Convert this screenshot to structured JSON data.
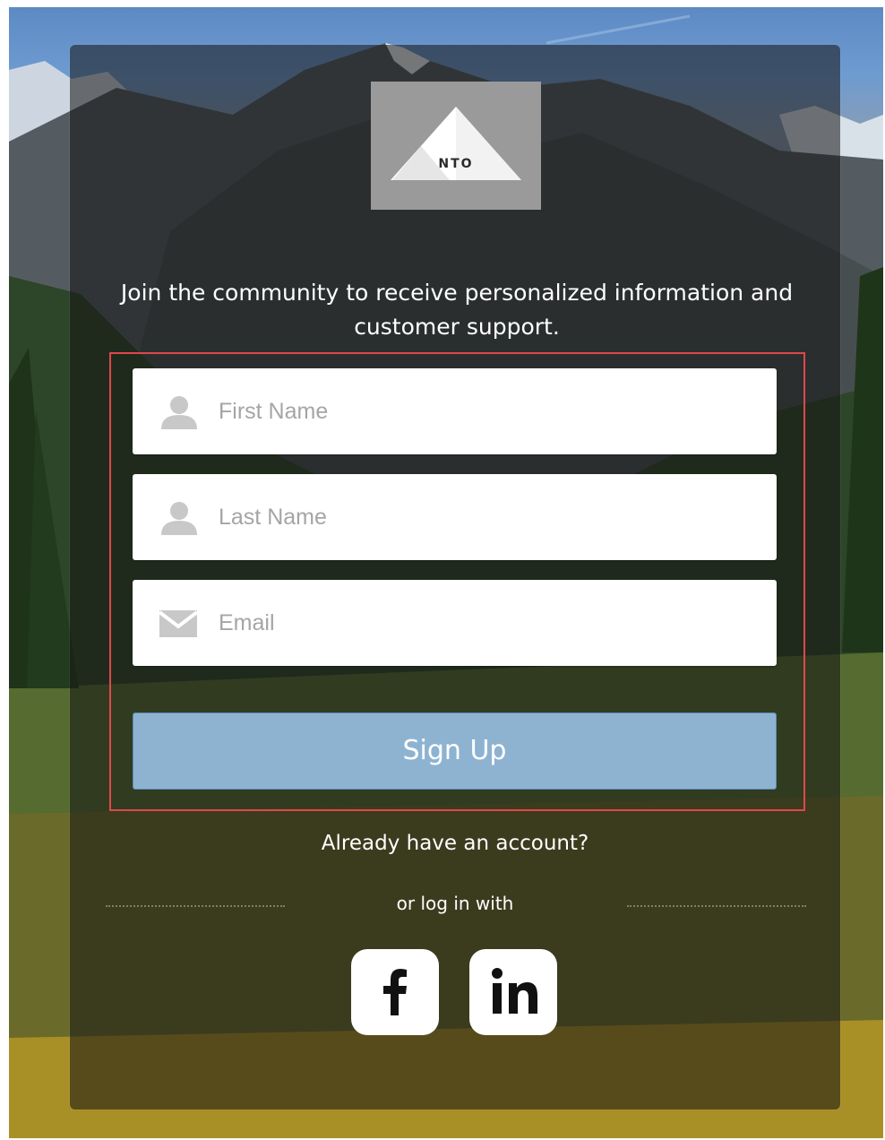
{
  "logo": {
    "text": "NTO"
  },
  "intro_text": "Join the community to receive personalized information and customer support.",
  "form": {
    "first_name_placeholder": "First Name",
    "last_name_placeholder": "Last Name",
    "email_placeholder": "Email",
    "signup_label": "Sign Up"
  },
  "already_text": "Already have an account?",
  "or_login_text": "or log in with",
  "social": [
    {
      "name": "facebook",
      "icon": "facebook-icon"
    },
    {
      "name": "linkedin",
      "icon": "linkedin-icon"
    }
  ],
  "colors": {
    "highlight_border": "#e0484a",
    "signup_button": "#8eb3d1",
    "card_overlay": "rgba(20,20,20,0.55)"
  }
}
